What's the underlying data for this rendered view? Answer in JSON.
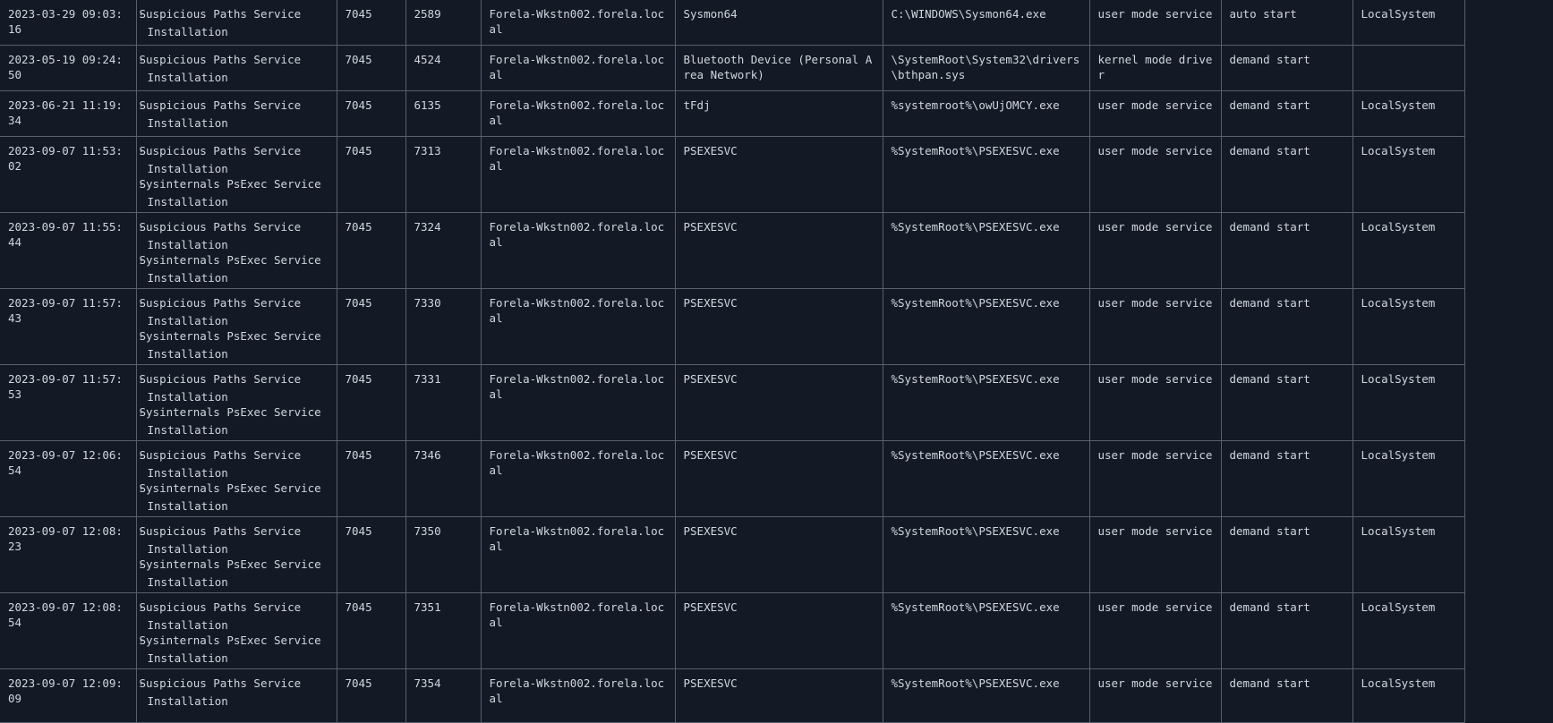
{
  "rule_bullet": "‣",
  "rows": [
    {
      "timestamp": "2023-03-29 09:03:16",
      "rules": [
        "Suspicious Paths Service Installation"
      ],
      "event_id": "7045",
      "record_id": "2589",
      "computer": "Forela-Wkstn002.forela.local",
      "service_name": "Sysmon64",
      "image_path": "C:\\WINDOWS\\Sysmon64.exe",
      "service_type": "user mode service",
      "start_type": "auto start",
      "account": "LocalSystem"
    },
    {
      "timestamp": "2023-05-19 09:24:50",
      "rules": [
        "Suspicious Paths Service Installation"
      ],
      "event_id": "7045",
      "record_id": "4524",
      "computer": "Forela-Wkstn002.forela.local",
      "service_name": "Bluetooth Device (Personal Area Network)",
      "image_path": "\\SystemRoot\\System32\\drivers\\bthpan.sys",
      "service_type": "kernel mode driver",
      "start_type": "demand start",
      "account": ""
    },
    {
      "timestamp": "2023-06-21 11:19:34",
      "rules": [
        "Suspicious Paths Service Installation"
      ],
      "event_id": "7045",
      "record_id": "6135",
      "computer": "Forela-Wkstn002.forela.local",
      "service_name": "tFdj",
      "image_path": "%systemroot%\\owUjOMCY.exe",
      "service_type": "user mode service",
      "start_type": "demand start",
      "account": "LocalSystem"
    },
    {
      "timestamp": "2023-09-07 11:53:02",
      "rules": [
        "Suspicious Paths Service Installation",
        "Sysinternals PsExec Service Installation"
      ],
      "event_id": "7045",
      "record_id": "7313",
      "computer": "Forela-Wkstn002.forela.local",
      "service_name": "PSEXESVC",
      "image_path": "%SystemRoot%\\PSEXESVC.exe",
      "service_type": "user mode service",
      "start_type": "demand start",
      "account": "LocalSystem"
    },
    {
      "timestamp": "2023-09-07 11:55:44",
      "rules": [
        "Suspicious Paths Service Installation",
        "Sysinternals PsExec Service Installation"
      ],
      "event_id": "7045",
      "record_id": "7324",
      "computer": "Forela-Wkstn002.forela.local",
      "service_name": "PSEXESVC",
      "image_path": "%SystemRoot%\\PSEXESVC.exe",
      "service_type": "user mode service",
      "start_type": "demand start",
      "account": "LocalSystem"
    },
    {
      "timestamp": "2023-09-07 11:57:43",
      "rules": [
        "Suspicious Paths Service Installation",
        "Sysinternals PsExec Service Installation"
      ],
      "event_id": "7045",
      "record_id": "7330",
      "computer": "Forela-Wkstn002.forela.local",
      "service_name": "PSEXESVC",
      "image_path": "%SystemRoot%\\PSEXESVC.exe",
      "service_type": "user mode service",
      "start_type": "demand start",
      "account": "LocalSystem"
    },
    {
      "timestamp": "2023-09-07 11:57:53",
      "rules": [
        "Suspicious Paths Service Installation",
        "Sysinternals PsExec Service Installation"
      ],
      "event_id": "7045",
      "record_id": "7331",
      "computer": "Forela-Wkstn002.forela.local",
      "service_name": "PSEXESVC",
      "image_path": "%SystemRoot%\\PSEXESVC.exe",
      "service_type": "user mode service",
      "start_type": "demand start",
      "account": "LocalSystem"
    },
    {
      "timestamp": "2023-09-07 12:06:54",
      "rules": [
        "Suspicious Paths Service Installation",
        "Sysinternals PsExec Service Installation"
      ],
      "event_id": "7045",
      "record_id": "7346",
      "computer": "Forela-Wkstn002.forela.local",
      "service_name": "PSEXESVC",
      "image_path": "%SystemRoot%\\PSEXESVC.exe",
      "service_type": "user mode service",
      "start_type": "demand start",
      "account": "LocalSystem"
    },
    {
      "timestamp": "2023-09-07 12:08:23",
      "rules": [
        "Suspicious Paths Service Installation",
        "Sysinternals PsExec Service Installation"
      ],
      "event_id": "7045",
      "record_id": "7350",
      "computer": "Forela-Wkstn002.forela.local",
      "service_name": "PSEXESVC",
      "image_path": "%SystemRoot%\\PSEXESVC.exe",
      "service_type": "user mode service",
      "start_type": "demand start",
      "account": "LocalSystem"
    },
    {
      "timestamp": "2023-09-07 12:08:54",
      "rules": [
        "Suspicious Paths Service Installation",
        "Sysinternals PsExec Service Installation"
      ],
      "event_id": "7045",
      "record_id": "7351",
      "computer": "Forela-Wkstn002.forela.local",
      "service_name": "PSEXESVC",
      "image_path": "%SystemRoot%\\PSEXESVC.exe",
      "service_type": "user mode service",
      "start_type": "demand start",
      "account": "LocalSystem"
    },
    {
      "timestamp": "2023-09-07 12:09:09",
      "rules": [
        "Suspicious Paths Service Installation"
      ],
      "event_id": "7045",
      "record_id": "7354",
      "computer": "Forela-Wkstn002.forela.local",
      "service_name": "PSEXESVC",
      "image_path": "%SystemRoot%\\PSEXESVC.exe",
      "service_type": "user mode service",
      "start_type": "demand start",
      "account": "LocalSystem"
    }
  ]
}
